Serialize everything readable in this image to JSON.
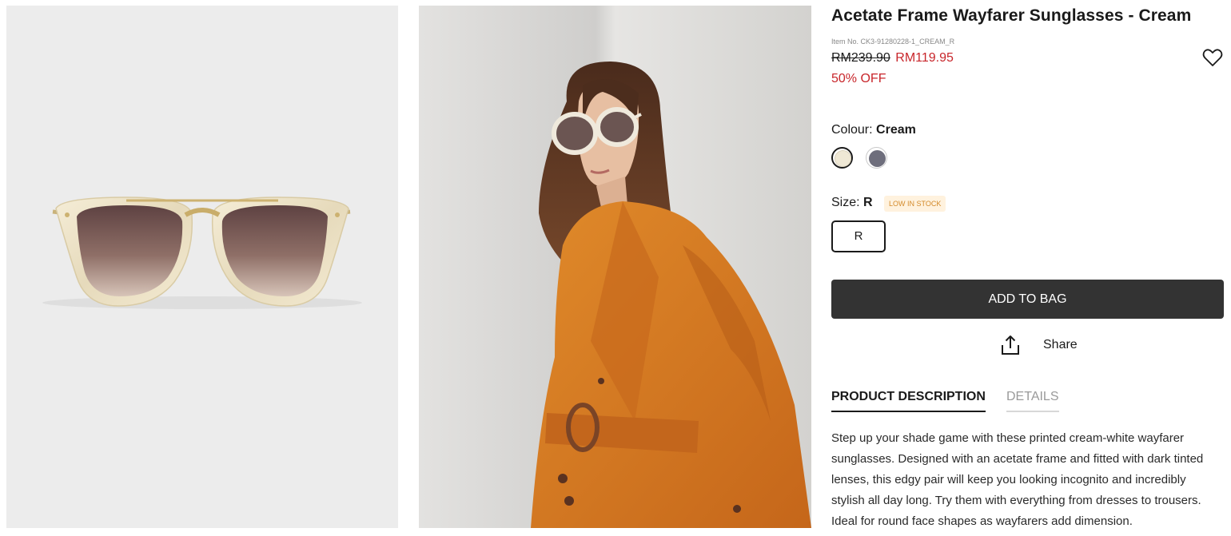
{
  "product": {
    "title": "Acetate Frame Wayfarer Sunglasses - Cream",
    "item_no": "Item No. CK3-91280228-1_CREAM_R",
    "old_price": "RM239.90",
    "new_price": "RM119.95",
    "discount": "50% OFF"
  },
  "colour": {
    "label": "Colour:",
    "selected": "Cream",
    "swatches": [
      "#efe8d5",
      "#6e6e7c"
    ]
  },
  "size": {
    "label": "Size:",
    "selected": "R",
    "stock_badge": "LOW IN STOCK",
    "options": [
      "R"
    ]
  },
  "actions": {
    "add_to_bag": "ADD TO BAG",
    "share": "Share"
  },
  "tabs": {
    "description": "PRODUCT DESCRIPTION",
    "details": "DETAILS"
  },
  "description": "Step up your shade game with these printed cream-white wayfarer sunglasses. Designed with an acetate frame and fitted with dark tinted lenses, this edgy pair will keep you looking incognito and incredibly stylish all day long. Try them with everything from dresses to trousers. Ideal for round face shapes as wayfarers add dimension.",
  "colors": {
    "sale": "#c8262b",
    "button": "#333333",
    "badge_bg": "#fff2de",
    "badge_text": "#d38a2a",
    "blazer": "#d77a20"
  },
  "icons": [
    "heart-icon",
    "share-icon"
  ]
}
